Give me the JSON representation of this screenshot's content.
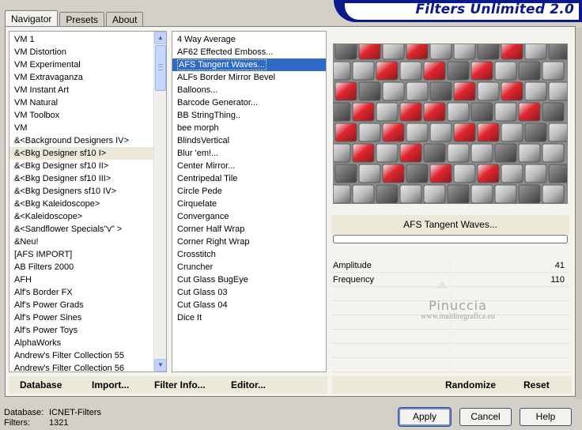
{
  "tabs": [
    "Navigator",
    "Presets",
    "About"
  ],
  "banner_title": "Filters Unlimited 2.0",
  "categories": [
    "VM 1",
    "VM Distortion",
    "VM Experimental",
    "VM Extravaganza",
    "VM Instant Art",
    "VM Natural",
    "VM Toolbox",
    "VM",
    "&<Background Designers IV>",
    "&<Bkg Designer sf10 I>",
    "&<Bkg Designer sf10 II>",
    "&<Bkg Designer sf10 III>",
    "&<Bkg Designers sf10 IV>",
    "&<Bkg Kaleidoscope>",
    "&<Kaleidoscope>",
    "&<Sandflower Specials\"v\" >",
    "&Neu!",
    "[AFS IMPORT]",
    "AB Filters 2000",
    "AFH",
    "Alf's Border FX",
    "Alf's Power Grads",
    "Alf's Power Sines",
    "Alf's Power Toys",
    "AlphaWorks",
    "Andrew's Filter Collection 55",
    "Andrew's Filter Collection 56"
  ],
  "selected_category": "&<Bkg Designer sf10 I>",
  "filters": [
    "4 Way Average",
    "AF62 Effected Emboss...",
    "AFS Tangent Waves...",
    "ALFs Border Mirror Bevel",
    "Balloons...",
    "Barcode Generator...",
    "BB StringThing..",
    "bee morph",
    "BlindsVertical",
    "Blur 'em!...",
    "Center Mirror...",
    "Centripedal Tile",
    "Circle Pede",
    "Cirquelate",
    "Convergance",
    "Corner Half Wrap",
    "Corner Right Wrap",
    "Crosstitch",
    "Cruncher",
    "Cut Glass  BugEye",
    "Cut Glass 03",
    "Cut Glass 04",
    "Dice It"
  ],
  "selected_filter": "AFS Tangent Waves...",
  "current_filter_name": "AFS Tangent Waves...",
  "params": [
    {
      "name": "Amplitude",
      "value": "41"
    },
    {
      "name": "Frequency",
      "value": "110"
    }
  ],
  "watermark": {
    "line1": "Pinuccia",
    "line2": "www.maidiregrafica.eu"
  },
  "bottom_bar": {
    "database": "Database",
    "import": "Import...",
    "filter_info": "Filter Info...",
    "editor": "Editor...",
    "randomize": "Randomize",
    "reset": "Reset"
  },
  "footer": {
    "database_label": "Database:",
    "database_value": "ICNET-Filters",
    "filters_label": "Filters:",
    "filters_value": "1321"
  },
  "buttons": {
    "apply": "Apply",
    "cancel": "Cancel",
    "help": "Help"
  },
  "colors": {
    "banner": "#0a1a8a",
    "selection": "#316ac5",
    "preview_red": "#d4202a"
  }
}
